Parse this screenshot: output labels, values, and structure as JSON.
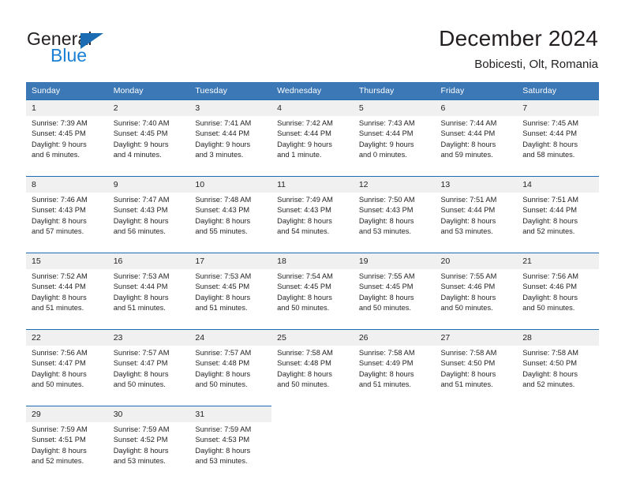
{
  "brand": {
    "name_part1": "General",
    "name_part2": "Blue",
    "triangle_color": "#1b6cb3",
    "blue_color": "#1b7fd4"
  },
  "header": {
    "title": "December 2024",
    "subtitle": "Bobicesti, Olt, Romania"
  },
  "theme": {
    "header_blue": "#3c78b5",
    "separator_blue": "#1b6cb3",
    "daynum_background": "#f0f0f0",
    "text_color": "#231f20"
  },
  "weekday_headers": [
    "Sunday",
    "Monday",
    "Tuesday",
    "Wednesday",
    "Thursday",
    "Friday",
    "Saturday"
  ],
  "weeks": [
    {
      "days": [
        {
          "date": "1",
          "sunrise": "Sunrise: 7:39 AM",
          "sunset": "Sunset: 4:45 PM",
          "daylight1": "Daylight: 9 hours",
          "daylight2": "and 6 minutes."
        },
        {
          "date": "2",
          "sunrise": "Sunrise: 7:40 AM",
          "sunset": "Sunset: 4:45 PM",
          "daylight1": "Daylight: 9 hours",
          "daylight2": "and 4 minutes."
        },
        {
          "date": "3",
          "sunrise": "Sunrise: 7:41 AM",
          "sunset": "Sunset: 4:44 PM",
          "daylight1": "Daylight: 9 hours",
          "daylight2": "and 3 minutes."
        },
        {
          "date": "4",
          "sunrise": "Sunrise: 7:42 AM",
          "sunset": "Sunset: 4:44 PM",
          "daylight1": "Daylight: 9 hours",
          "daylight2": "and 1 minute."
        },
        {
          "date": "5",
          "sunrise": "Sunrise: 7:43 AM",
          "sunset": "Sunset: 4:44 PM",
          "daylight1": "Daylight: 9 hours",
          "daylight2": "and 0 minutes."
        },
        {
          "date": "6",
          "sunrise": "Sunrise: 7:44 AM",
          "sunset": "Sunset: 4:44 PM",
          "daylight1": "Daylight: 8 hours",
          "daylight2": "and 59 minutes."
        },
        {
          "date": "7",
          "sunrise": "Sunrise: 7:45 AM",
          "sunset": "Sunset: 4:44 PM",
          "daylight1": "Daylight: 8 hours",
          "daylight2": "and 58 minutes."
        }
      ]
    },
    {
      "days": [
        {
          "date": "8",
          "sunrise": "Sunrise: 7:46 AM",
          "sunset": "Sunset: 4:43 PM",
          "daylight1": "Daylight: 8 hours",
          "daylight2": "and 57 minutes."
        },
        {
          "date": "9",
          "sunrise": "Sunrise: 7:47 AM",
          "sunset": "Sunset: 4:43 PM",
          "daylight1": "Daylight: 8 hours",
          "daylight2": "and 56 minutes."
        },
        {
          "date": "10",
          "sunrise": "Sunrise: 7:48 AM",
          "sunset": "Sunset: 4:43 PM",
          "daylight1": "Daylight: 8 hours",
          "daylight2": "and 55 minutes."
        },
        {
          "date": "11",
          "sunrise": "Sunrise: 7:49 AM",
          "sunset": "Sunset: 4:43 PM",
          "daylight1": "Daylight: 8 hours",
          "daylight2": "and 54 minutes."
        },
        {
          "date": "12",
          "sunrise": "Sunrise: 7:50 AM",
          "sunset": "Sunset: 4:43 PM",
          "daylight1": "Daylight: 8 hours",
          "daylight2": "and 53 minutes."
        },
        {
          "date": "13",
          "sunrise": "Sunrise: 7:51 AM",
          "sunset": "Sunset: 4:44 PM",
          "daylight1": "Daylight: 8 hours",
          "daylight2": "and 53 minutes."
        },
        {
          "date": "14",
          "sunrise": "Sunrise: 7:51 AM",
          "sunset": "Sunset: 4:44 PM",
          "daylight1": "Daylight: 8 hours",
          "daylight2": "and 52 minutes."
        }
      ]
    },
    {
      "days": [
        {
          "date": "15",
          "sunrise": "Sunrise: 7:52 AM",
          "sunset": "Sunset: 4:44 PM",
          "daylight1": "Daylight: 8 hours",
          "daylight2": "and 51 minutes."
        },
        {
          "date": "16",
          "sunrise": "Sunrise: 7:53 AM",
          "sunset": "Sunset: 4:44 PM",
          "daylight1": "Daylight: 8 hours",
          "daylight2": "and 51 minutes."
        },
        {
          "date": "17",
          "sunrise": "Sunrise: 7:53 AM",
          "sunset": "Sunset: 4:45 PM",
          "daylight1": "Daylight: 8 hours",
          "daylight2": "and 51 minutes."
        },
        {
          "date": "18",
          "sunrise": "Sunrise: 7:54 AM",
          "sunset": "Sunset: 4:45 PM",
          "daylight1": "Daylight: 8 hours",
          "daylight2": "and 50 minutes."
        },
        {
          "date": "19",
          "sunrise": "Sunrise: 7:55 AM",
          "sunset": "Sunset: 4:45 PM",
          "daylight1": "Daylight: 8 hours",
          "daylight2": "and 50 minutes."
        },
        {
          "date": "20",
          "sunrise": "Sunrise: 7:55 AM",
          "sunset": "Sunset: 4:46 PM",
          "daylight1": "Daylight: 8 hours",
          "daylight2": "and 50 minutes."
        },
        {
          "date": "21",
          "sunrise": "Sunrise: 7:56 AM",
          "sunset": "Sunset: 4:46 PM",
          "daylight1": "Daylight: 8 hours",
          "daylight2": "and 50 minutes."
        }
      ]
    },
    {
      "days": [
        {
          "date": "22",
          "sunrise": "Sunrise: 7:56 AM",
          "sunset": "Sunset: 4:47 PM",
          "daylight1": "Daylight: 8 hours",
          "daylight2": "and 50 minutes."
        },
        {
          "date": "23",
          "sunrise": "Sunrise: 7:57 AM",
          "sunset": "Sunset: 4:47 PM",
          "daylight1": "Daylight: 8 hours",
          "daylight2": "and 50 minutes."
        },
        {
          "date": "24",
          "sunrise": "Sunrise: 7:57 AM",
          "sunset": "Sunset: 4:48 PM",
          "daylight1": "Daylight: 8 hours",
          "daylight2": "and 50 minutes."
        },
        {
          "date": "25",
          "sunrise": "Sunrise: 7:58 AM",
          "sunset": "Sunset: 4:48 PM",
          "daylight1": "Daylight: 8 hours",
          "daylight2": "and 50 minutes."
        },
        {
          "date": "26",
          "sunrise": "Sunrise: 7:58 AM",
          "sunset": "Sunset: 4:49 PM",
          "daylight1": "Daylight: 8 hours",
          "daylight2": "and 51 minutes."
        },
        {
          "date": "27",
          "sunrise": "Sunrise: 7:58 AM",
          "sunset": "Sunset: 4:50 PM",
          "daylight1": "Daylight: 8 hours",
          "daylight2": "and 51 minutes."
        },
        {
          "date": "28",
          "sunrise": "Sunrise: 7:58 AM",
          "sunset": "Sunset: 4:50 PM",
          "daylight1": "Daylight: 8 hours",
          "daylight2": "and 52 minutes."
        }
      ]
    },
    {
      "days": [
        {
          "date": "29",
          "sunrise": "Sunrise: 7:59 AM",
          "sunset": "Sunset: 4:51 PM",
          "daylight1": "Daylight: 8 hours",
          "daylight2": "and 52 minutes."
        },
        {
          "date": "30",
          "sunrise": "Sunrise: 7:59 AM",
          "sunset": "Sunset: 4:52 PM",
          "daylight1": "Daylight: 8 hours",
          "daylight2": "and 53 minutes."
        },
        {
          "date": "31",
          "sunrise": "Sunrise: 7:59 AM",
          "sunset": "Sunset: 4:53 PM",
          "daylight1": "Daylight: 8 hours",
          "daylight2": "and 53 minutes."
        },
        {
          "date": "",
          "sunrise": "",
          "sunset": "",
          "daylight1": "",
          "daylight2": ""
        },
        {
          "date": "",
          "sunrise": "",
          "sunset": "",
          "daylight1": "",
          "daylight2": ""
        },
        {
          "date": "",
          "sunrise": "",
          "sunset": "",
          "daylight1": "",
          "daylight2": ""
        },
        {
          "date": "",
          "sunrise": "",
          "sunset": "",
          "daylight1": "",
          "daylight2": ""
        }
      ]
    }
  ]
}
